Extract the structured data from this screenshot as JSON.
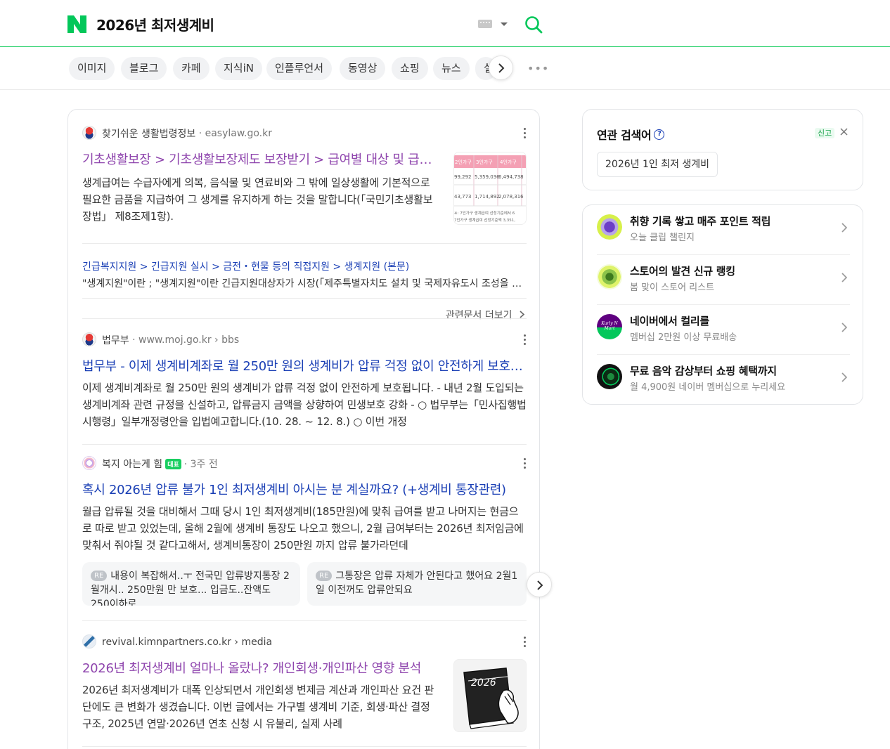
{
  "search": {
    "query": "2026년 최저생계비"
  },
  "tabs": [
    {
      "label": "이미지"
    },
    {
      "label": "블로그"
    },
    {
      "label": "카페"
    },
    {
      "label": "지식iN"
    },
    {
      "label": "인플루언서"
    },
    {
      "label": "동영상"
    },
    {
      "label": "쇼핑"
    },
    {
      "label": "뉴스"
    },
    {
      "label": "실"
    }
  ],
  "results": [
    {
      "site": "찾기쉬운 생활법령정보",
      "url": "· easylaw.go.kr",
      "title": "기초생활보장 > 기초생활보장제도 보장받기 > 급여별 대상 및 급여 내용",
      "desc": "생계급여는 수급자에게 의복, 음식물 및 연료비와 그 밖에 일상생활에 기본적으로 필요한 금품을 지급하여 그 생계를 유지하게 하는 것을 말합니다(「국민기초생활보장법」 제8조제1항).",
      "sublink_path": "긴급복지지원 > 긴급지원 실시 > 금전・현물 등의 직접지원 > 생계지원 (본문)",
      "sublink_desc": "\"생계지원\"이란 ; \"생계지원\"이란 긴급지원대상자가 시장(「제주특별자치도 설치 및 국제자유도시 조성을 위한 특별법」",
      "more_docs": "관련문서 더보기",
      "thumb": {
        "headers": [
          "2인가구",
          "3인가구",
          "4인가구"
        ],
        "row1": [
          "99,292",
          "5,359,036",
          "6,494,738"
        ],
        "row2": [
          "43,773",
          "1,714,892",
          "2,078,316"
        ],
        "note1": "※: 7인가구 생계급여 선정기준에서 6",
        "note2": "7인가구 생계급여 선정기준액 3,351,"
      }
    },
    {
      "site": "법무부",
      "url": "· www.moj.go.kr › bbs",
      "title": "법무부 - 이제 생계비계좌로 월 250만 원의 생계비가 압류 걱정 없이 안전하게 보호됩니다",
      "desc": "이제 생계비계좌로 월 250만 원의 생계비가 압류 걱정 없이 안전하게 보호됩니다. - 내년 2월 도입되는 생계비계좌 관련 규정을 신설하고, 압류금지 금액을 상향하여 민생보호 강화 - ○ 법무부는「민사집행법 시행령」일부개정령안을 입법예고합니다.(10. 28. ~ 12. 8.) ○ 이번 개정"
    },
    {
      "site": "복지 아는게 힘",
      "badge": "대표",
      "url": "· 3주 전",
      "title": "혹시 2026년 압류 불가 1인 최저생계비 아시는 분 계실까요? (+생계비 통장관련)",
      "desc": "월급 압류될 것을 대비해서 그때 당시 1인 최저생계비(185만원)에 맞춰 급여를 받고 나머지는 현금으로 따로 받고 있었는데, 올해 2월에 생계비 통장도 나오고 했으니, 2월 급여부터는 2026년 최저임금에 맞춰서 줘야될 것 같다고해서, 생계비통장이 250만원 까지 압류 불가라던데",
      "replies": [
        {
          "badge": "RE",
          "text": "내용이 복잡해서..ㅜ 전국민 압류방지통장 2월개시.. 250만원 만 보호... 입금도..잔액도 250이하로"
        },
        {
          "badge": "RE",
          "text": "그통장은 압류 자체가 안된다고 했어요 2월1일 이전꺼도 압류안되요"
        }
      ]
    },
    {
      "site": "revival.kimnpartners.co.kr › media",
      "title": "2026년 최저생계비 얼마나 올랐나? 개인회생·개인파산 영향 분석",
      "desc": "2026년 최저생계비가 대폭 인상되면서 개인회생 변제금 계산과 개인파산 요건 판단에도 큰 변화가 생겼습니다. 이번 글에서는 가구별 생계비 기준, 회생·파산 결정 구조, 2025년 연말·2026년 연초 신청 시 유불리, 실제 사례",
      "thumb_text": "2026"
    }
  ],
  "related": {
    "title": "연관 검색어",
    "help": "?",
    "report": "신고",
    "chips": [
      "2026년 1인 최저 생계비"
    ]
  },
  "promos": [
    {
      "title": "취향 기록 쌓고 매주 포인트 적립",
      "sub": "오늘 클립 챌린지"
    },
    {
      "title": "스토어의 발견 신규 랭킹",
      "sub": "봄 맞이 스토어 리스트"
    },
    {
      "title": "네이버에서 컬리를",
      "sub": "멤버십 2만원 이상 무료배송",
      "img_text": "Kurly N Mart"
    },
    {
      "title": "무료 음악 감상부터 쇼핑 혜택까지",
      "sub": "월 4,900원 네이버 멤버십으로 누리세요"
    }
  ],
  "colors": {
    "brand": "#19ce60",
    "link": "#1a3fb5",
    "visited": "#8e44ad"
  }
}
